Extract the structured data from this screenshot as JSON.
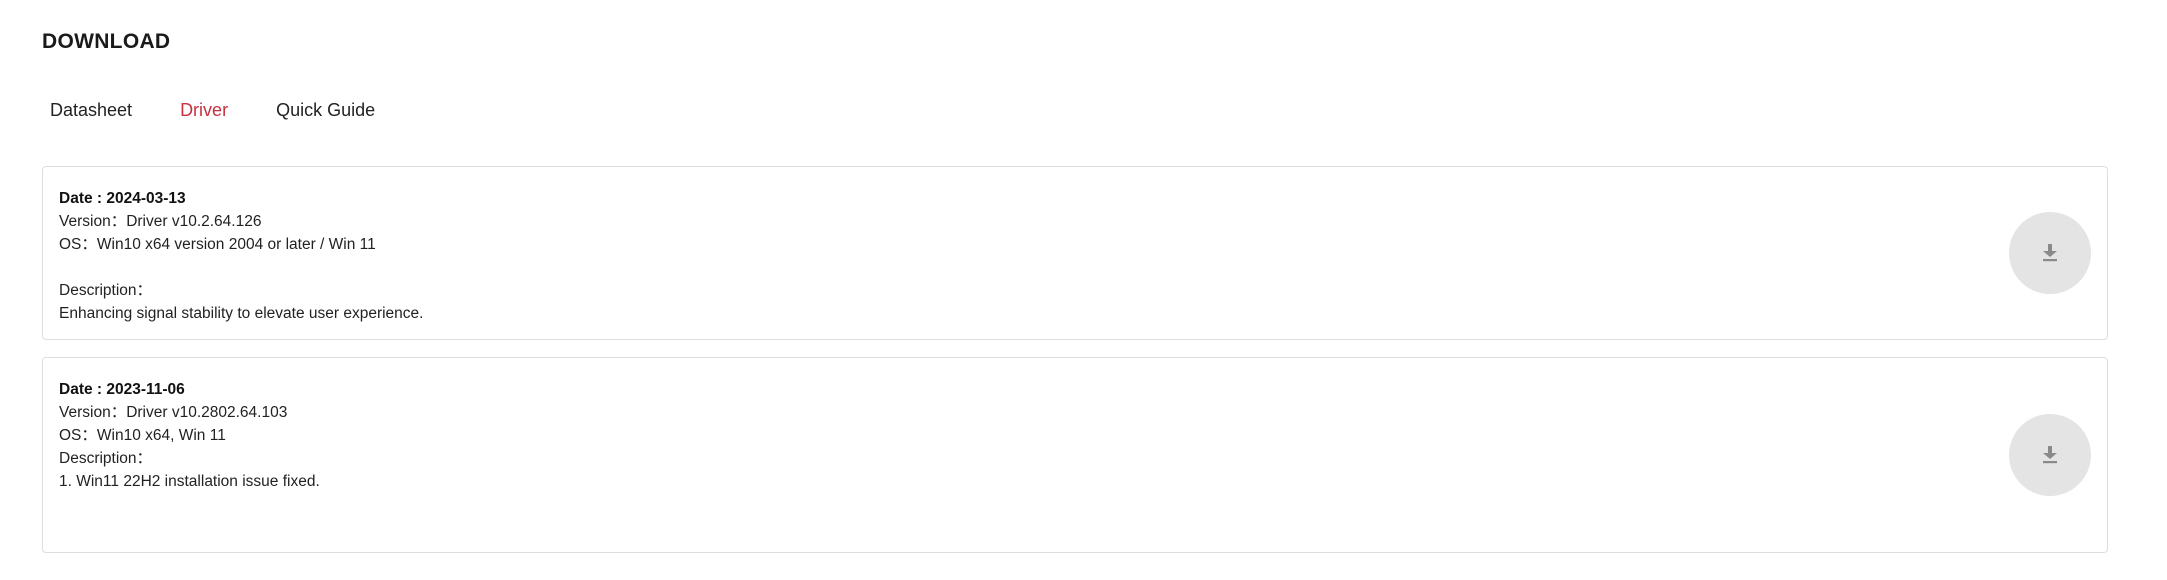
{
  "section": {
    "title": "DOWNLOAD"
  },
  "tabs": [
    {
      "label": "Datasheet",
      "active": false
    },
    {
      "label": "Driver",
      "active": true
    },
    {
      "label": "Quick Guide",
      "active": false
    }
  ],
  "colors": {
    "accent": "#c7323f",
    "button_bg": "#e4e4e4",
    "icon": "#8a8a8a",
    "border": "#dedede"
  },
  "downloads": [
    {
      "date": "Date : 2024-03-13",
      "version": "Version：Driver v10.2.64.126",
      "os": "OS：Win10 x64 version 2004 or later / Win 11",
      "description_label": "Description：",
      "description": "Enhancing signal stability to elevate user experience.",
      "button_icon": "download-icon"
    },
    {
      "date": "Date : 2023-11-06",
      "version": "Version：Driver v10.2802.64.103",
      "os": "OS：Win10 x64, Win 11",
      "description_label": "Description：",
      "description": "1. Win11 22H2 installation issue fixed.",
      "button_icon": "download-icon"
    }
  ]
}
